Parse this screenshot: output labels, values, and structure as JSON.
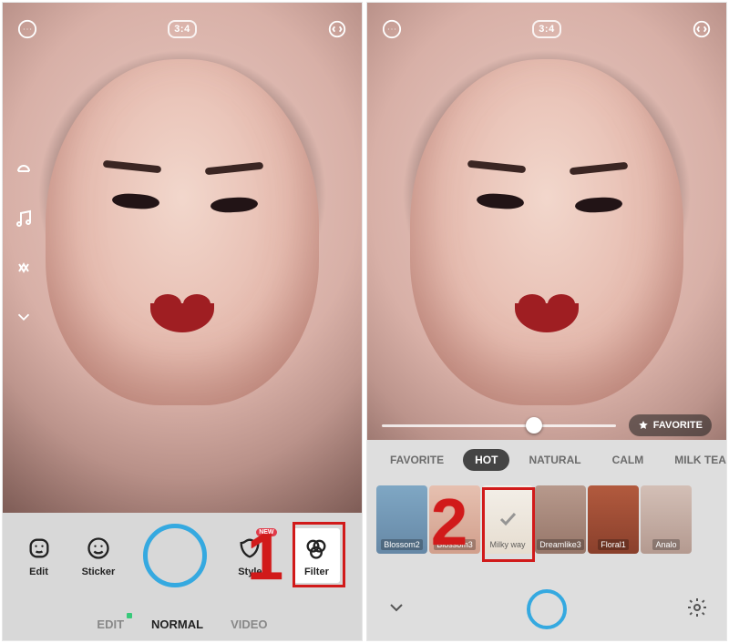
{
  "step_labels": {
    "one": "1",
    "two": "2"
  },
  "topbar": {
    "ratio": "3:4"
  },
  "left_rail": {
    "items": [
      {
        "name": "aperture-icon"
      },
      {
        "name": "music-icon"
      },
      {
        "name": "swap-icon"
      },
      {
        "name": "chevron-down-icon"
      }
    ]
  },
  "pane1": {
    "tools": {
      "edit": "Edit",
      "sticker": "Sticker",
      "beauty": "Style",
      "filter": "Filter",
      "new_badge": "NEW"
    },
    "tabs": {
      "edit": "EDIT",
      "normal": "NORMAL",
      "video": "VIDEO"
    }
  },
  "pane2": {
    "slider_value": 65,
    "favorite_chip": "FAVORITE",
    "categories": [
      {
        "label": "FAVORITE",
        "active": false
      },
      {
        "label": "HOT",
        "active": true
      },
      {
        "label": "NATURAL",
        "active": false
      },
      {
        "label": "CALM",
        "active": false
      },
      {
        "label": "MILK TEA",
        "active": false
      }
    ],
    "filters": [
      {
        "label": "Blossom2",
        "bg": "#7fa7c4"
      },
      {
        "label": "Blossom3",
        "bg": "#e0b7a7"
      },
      {
        "label": "Milky way",
        "selected": true
      },
      {
        "label": "Dreamlike3",
        "bg": "#b7998c"
      },
      {
        "label": "Floral1",
        "bg": "#a3503b"
      },
      {
        "label": "Analo",
        "bg": "#c6b1a8"
      }
    ]
  }
}
